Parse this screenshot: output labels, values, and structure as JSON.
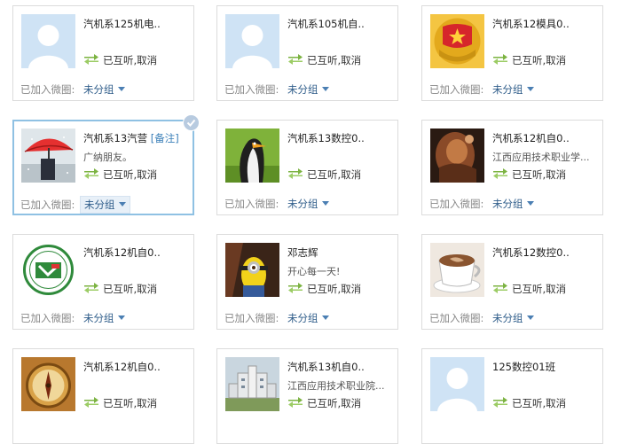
{
  "ui": {
    "group_label": "已加入微圈:",
    "follow_status": "已互听",
    "separator": ",",
    "cancel_label": "取消",
    "note_tag": "[备注]"
  },
  "colors": {
    "card_border": "#dcdcdc",
    "selected_border": "#8fc1e3",
    "link_blue": "#2f5d8a",
    "swap_icon_green": "#7cb342"
  },
  "cards": [
    {
      "name": "汽机系125机电..",
      "description": "",
      "group": "未分组",
      "avatar": "default-avatar-icon"
    },
    {
      "name": "汽机系105机自..",
      "description": "",
      "group": "未分组",
      "avatar": "default-avatar-icon"
    },
    {
      "name": "汽机系12模具0..",
      "description": "",
      "group": "未分组",
      "avatar": "youth-league-emblem-icon"
    },
    {
      "name": "汽机系13汽营",
      "description": "广纳朋友。",
      "group": "未分组",
      "avatar": "red-umbrella-photo"
    },
    {
      "name": "汽机系13数控0..",
      "description": "",
      "group": "未分组",
      "avatar": "penguin-photo"
    },
    {
      "name": "汽机系12机自0..",
      "description": "江西应用技术职业学...",
      "group": "未分组",
      "avatar": "painting-photo"
    },
    {
      "name": "汽机系12机自0..",
      "description": "",
      "group": "未分组",
      "avatar": "college-logo-icon"
    },
    {
      "name": "邓志辉",
      "description": "开心每一天!",
      "group": "未分组",
      "avatar": "minion-photo"
    },
    {
      "name": "汽机系12数控0..",
      "description": "",
      "group": "未分组",
      "avatar": "coffee-cup-photo"
    },
    {
      "name": "汽机系12机自0..",
      "description": "",
      "group": "",
      "avatar": "compass-photo"
    },
    {
      "name": "汽机系13机自0..",
      "description": "江西应用技术职业院...",
      "group": "",
      "avatar": "building-photo"
    },
    {
      "name": "125数控01班",
      "description": "",
      "group": "",
      "avatar": "default-avatar-icon"
    }
  ]
}
